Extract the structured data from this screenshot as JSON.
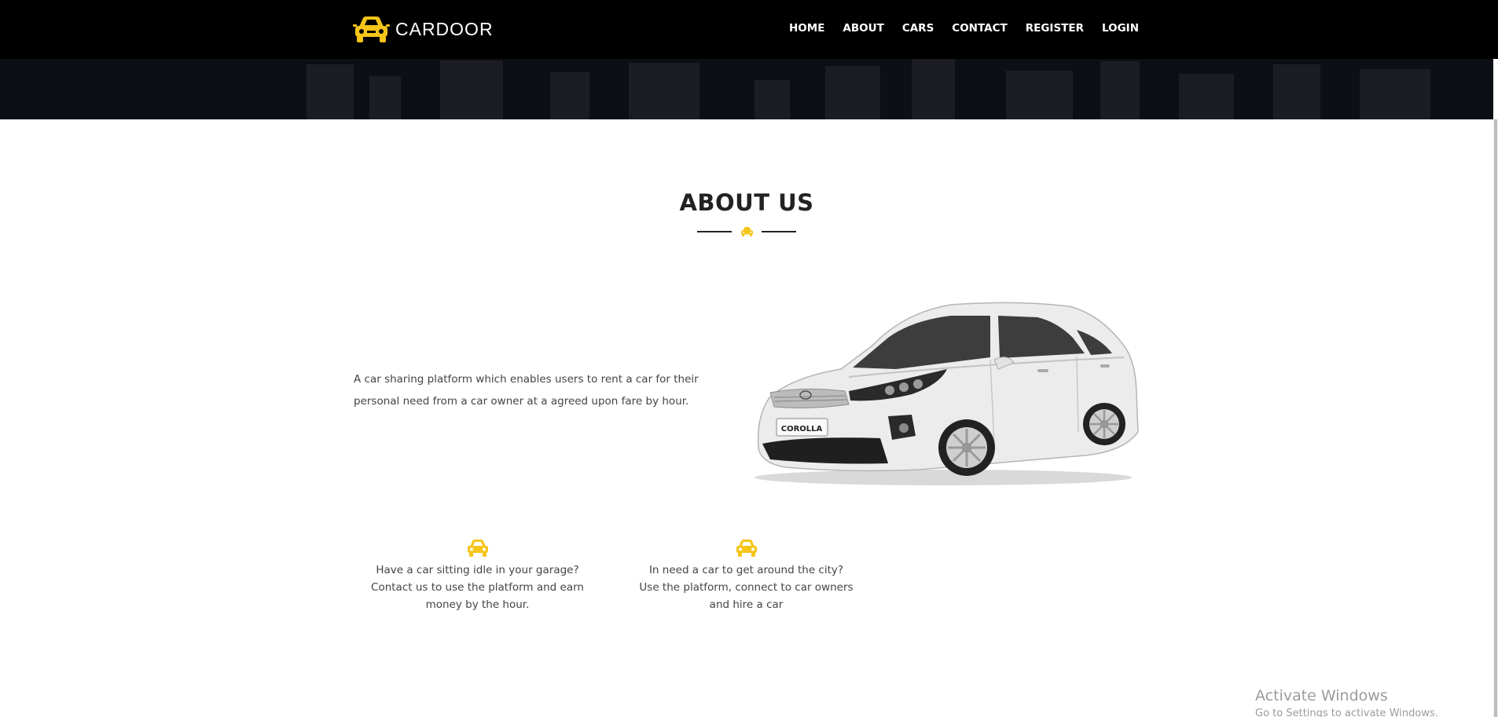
{
  "brand": {
    "name": "CARDOOR",
    "logo_icon": "car-icon",
    "accent_color": "#f5c518"
  },
  "nav": {
    "items": [
      "HOME",
      "ABOUT",
      "CARS",
      "CONTACT",
      "REGISTER",
      "LOGIN"
    ]
  },
  "about": {
    "title": "ABOUT US",
    "divider_icon": "car-icon",
    "description": "A car sharing platform which enables users to rent a car for their personal need from a car owner at a agreed upon fare by hour.",
    "car_image_label": "COROLLA"
  },
  "features": [
    {
      "icon": "car-icon",
      "text": "Have a car sitting idle in your garage? Contact us to use the platform and earn money by the hour."
    },
    {
      "icon": "car-icon",
      "text": "In need a car to get around the city? Use the platform, connect to car owners and hire a car"
    }
  ],
  "watermark": {
    "title": "Activate Windows",
    "subtitle": "Go to Settings to activate Windows."
  }
}
